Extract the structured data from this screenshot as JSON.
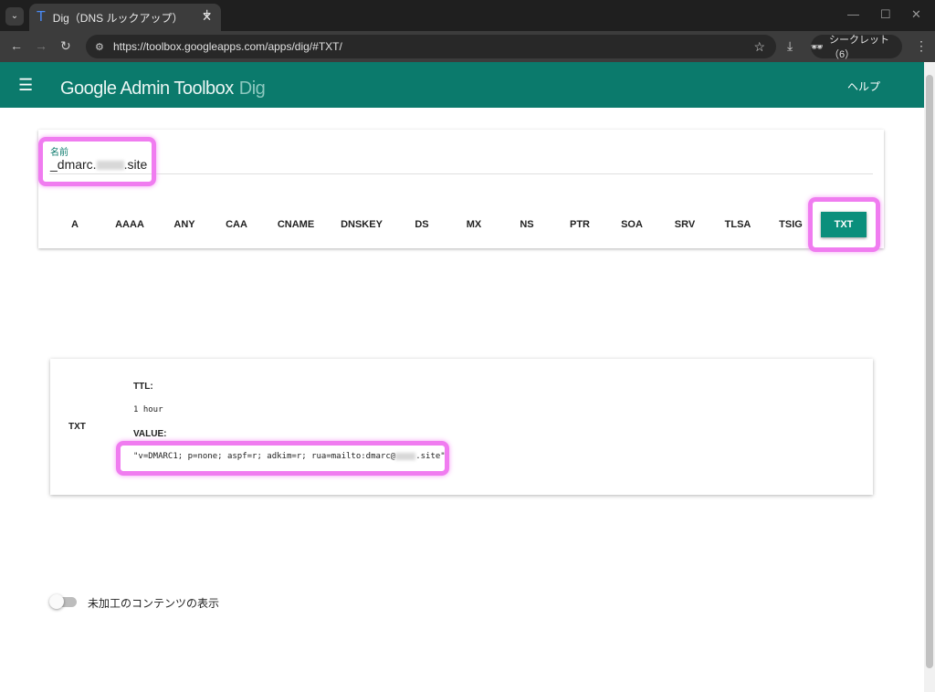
{
  "browser": {
    "tab_title": "Dig（DNS ルックアップ）",
    "tab_icon": "T",
    "url": "https://toolbox.googleapps.com/apps/dig/#TXT/",
    "incognito_label": "シークレット（6）"
  },
  "header": {
    "brand": "Google Admin Toolbox",
    "app": "Dig",
    "help": "ヘルプ",
    "color": "#0b7a6c"
  },
  "form": {
    "name_label": "名前",
    "name_prefix": "_dmarc.",
    "name_suffix": ".site",
    "record_types": [
      "A",
      "AAAA",
      "ANY",
      "CAA",
      "CNAME",
      "DNSKEY",
      "DS",
      "MX",
      "NS",
      "PTR",
      "SOA",
      "SRV",
      "TLSA",
      "TSIG",
      "TXT"
    ],
    "selected": "TXT"
  },
  "result": {
    "type": "TXT",
    "ttl_label": "TTL:",
    "ttl_value": "1 hour",
    "value_label": "VALUE:",
    "value_prefix": "\"v=DMARC1; p=none; aspf=r; adkim=r; rua=mailto:dmarc@",
    "value_suffix": ".site\""
  },
  "raw_toggle": {
    "label": "未加工のコンテンツの表示",
    "on": false
  },
  "highlight_color": "#f07cf0"
}
